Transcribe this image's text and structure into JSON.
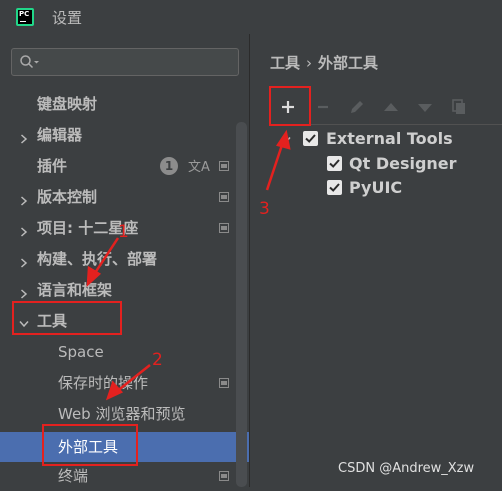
{
  "window": {
    "title": "设置",
    "app_icon_text": "PC"
  },
  "search": {
    "placeholder": "",
    "value": ""
  },
  "sidebar": {
    "items": [
      {
        "label": "键盘映射"
      },
      {
        "label": "编辑器"
      },
      {
        "label": "插件",
        "badge_count": "1"
      },
      {
        "label": "版本控制"
      },
      {
        "label": "项目: 十二星座"
      },
      {
        "label": "构建、执行、部署"
      },
      {
        "label": "语言和框架"
      },
      {
        "label": "工具",
        "expanded": true
      },
      {
        "label": "Space"
      },
      {
        "label": "保存时的操作"
      },
      {
        "label": "Web 浏览器和预览"
      },
      {
        "label": "外部工具",
        "selected": true
      },
      {
        "label": "终端"
      }
    ]
  },
  "breadcrumb": {
    "parent": "工具",
    "separator": "›",
    "current": "外部工具"
  },
  "toolbar": {
    "buttons": [
      {
        "icon": "plus-icon",
        "enabled": true
      },
      {
        "icon": "minus-icon",
        "enabled": false
      },
      {
        "icon": "pencil-icon",
        "enabled": false
      },
      {
        "icon": "arrow-up-icon",
        "enabled": false
      },
      {
        "icon": "arrow-down-icon",
        "enabled": false
      },
      {
        "icon": "copy-icon",
        "enabled": false
      }
    ]
  },
  "tools_tree": {
    "group": {
      "label": "External Tools",
      "checked": true,
      "expanded": true
    },
    "children": [
      {
        "label": "Qt Designer",
        "checked": true
      },
      {
        "label": "PyUIC",
        "checked": true
      }
    ]
  },
  "annotations": {
    "label_1": "1",
    "label_2": "2",
    "label_3": "3"
  },
  "watermark": "CSDN @Andrew_Xzw",
  "colors": {
    "selection": "#4b6eaf",
    "annotation": "#e3211f",
    "background": "#3c3f41"
  }
}
